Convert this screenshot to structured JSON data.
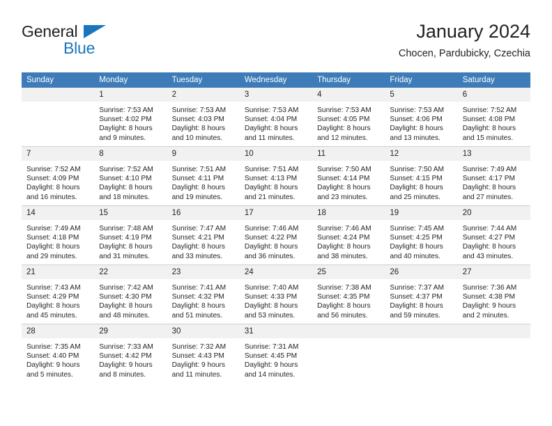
{
  "brand": {
    "line1": "General",
    "line2": "Blue",
    "accent_color": "#1b75bb",
    "text_color": "#231f20"
  },
  "header": {
    "title": "January 2024",
    "subtitle": "Chocen, Pardubicky, Czechia"
  },
  "calendar": {
    "header_bg": "#3d7cb8",
    "daynum_bg": "#f1f1f1",
    "weekday_labels": [
      "Sunday",
      "Monday",
      "Tuesday",
      "Wednesday",
      "Thursday",
      "Friday",
      "Saturday"
    ],
    "labels": {
      "sunrise_prefix": "Sunrise:",
      "sunset_prefix": "Sunset:",
      "daylight_prefix": "Daylight:"
    },
    "weeks": [
      [
        {
          "day": "",
          "blank": true
        },
        {
          "day": "1",
          "sunrise": "Sunrise: 7:53 AM",
          "sunset": "Sunset: 4:02 PM",
          "daylight": "Daylight: 8 hours and 9 minutes."
        },
        {
          "day": "2",
          "sunrise": "Sunrise: 7:53 AM",
          "sunset": "Sunset: 4:03 PM",
          "daylight": "Daylight: 8 hours and 10 minutes."
        },
        {
          "day": "3",
          "sunrise": "Sunrise: 7:53 AM",
          "sunset": "Sunset: 4:04 PM",
          "daylight": "Daylight: 8 hours and 11 minutes."
        },
        {
          "day": "4",
          "sunrise": "Sunrise: 7:53 AM",
          "sunset": "Sunset: 4:05 PM",
          "daylight": "Daylight: 8 hours and 12 minutes."
        },
        {
          "day": "5",
          "sunrise": "Sunrise: 7:53 AM",
          "sunset": "Sunset: 4:06 PM",
          "daylight": "Daylight: 8 hours and 13 minutes."
        },
        {
          "day": "6",
          "sunrise": "Sunrise: 7:52 AM",
          "sunset": "Sunset: 4:08 PM",
          "daylight": "Daylight: 8 hours and 15 minutes."
        }
      ],
      [
        {
          "day": "7",
          "sunrise": "Sunrise: 7:52 AM",
          "sunset": "Sunset: 4:09 PM",
          "daylight": "Daylight: 8 hours and 16 minutes."
        },
        {
          "day": "8",
          "sunrise": "Sunrise: 7:52 AM",
          "sunset": "Sunset: 4:10 PM",
          "daylight": "Daylight: 8 hours and 18 minutes."
        },
        {
          "day": "9",
          "sunrise": "Sunrise: 7:51 AM",
          "sunset": "Sunset: 4:11 PM",
          "daylight": "Daylight: 8 hours and 19 minutes."
        },
        {
          "day": "10",
          "sunrise": "Sunrise: 7:51 AM",
          "sunset": "Sunset: 4:13 PM",
          "daylight": "Daylight: 8 hours and 21 minutes."
        },
        {
          "day": "11",
          "sunrise": "Sunrise: 7:50 AM",
          "sunset": "Sunset: 4:14 PM",
          "daylight": "Daylight: 8 hours and 23 minutes."
        },
        {
          "day": "12",
          "sunrise": "Sunrise: 7:50 AM",
          "sunset": "Sunset: 4:15 PM",
          "daylight": "Daylight: 8 hours and 25 minutes."
        },
        {
          "day": "13",
          "sunrise": "Sunrise: 7:49 AM",
          "sunset": "Sunset: 4:17 PM",
          "daylight": "Daylight: 8 hours and 27 minutes."
        }
      ],
      [
        {
          "day": "14",
          "sunrise": "Sunrise: 7:49 AM",
          "sunset": "Sunset: 4:18 PM",
          "daylight": "Daylight: 8 hours and 29 minutes."
        },
        {
          "day": "15",
          "sunrise": "Sunrise: 7:48 AM",
          "sunset": "Sunset: 4:19 PM",
          "daylight": "Daylight: 8 hours and 31 minutes."
        },
        {
          "day": "16",
          "sunrise": "Sunrise: 7:47 AM",
          "sunset": "Sunset: 4:21 PM",
          "daylight": "Daylight: 8 hours and 33 minutes."
        },
        {
          "day": "17",
          "sunrise": "Sunrise: 7:46 AM",
          "sunset": "Sunset: 4:22 PM",
          "daylight": "Daylight: 8 hours and 36 minutes."
        },
        {
          "day": "18",
          "sunrise": "Sunrise: 7:46 AM",
          "sunset": "Sunset: 4:24 PM",
          "daylight": "Daylight: 8 hours and 38 minutes."
        },
        {
          "day": "19",
          "sunrise": "Sunrise: 7:45 AM",
          "sunset": "Sunset: 4:25 PM",
          "daylight": "Daylight: 8 hours and 40 minutes."
        },
        {
          "day": "20",
          "sunrise": "Sunrise: 7:44 AM",
          "sunset": "Sunset: 4:27 PM",
          "daylight": "Daylight: 8 hours and 43 minutes."
        }
      ],
      [
        {
          "day": "21",
          "sunrise": "Sunrise: 7:43 AM",
          "sunset": "Sunset: 4:29 PM",
          "daylight": "Daylight: 8 hours and 45 minutes."
        },
        {
          "day": "22",
          "sunrise": "Sunrise: 7:42 AM",
          "sunset": "Sunset: 4:30 PM",
          "daylight": "Daylight: 8 hours and 48 minutes."
        },
        {
          "day": "23",
          "sunrise": "Sunrise: 7:41 AM",
          "sunset": "Sunset: 4:32 PM",
          "daylight": "Daylight: 8 hours and 51 minutes."
        },
        {
          "day": "24",
          "sunrise": "Sunrise: 7:40 AM",
          "sunset": "Sunset: 4:33 PM",
          "daylight": "Daylight: 8 hours and 53 minutes."
        },
        {
          "day": "25",
          "sunrise": "Sunrise: 7:38 AM",
          "sunset": "Sunset: 4:35 PM",
          "daylight": "Daylight: 8 hours and 56 minutes."
        },
        {
          "day": "26",
          "sunrise": "Sunrise: 7:37 AM",
          "sunset": "Sunset: 4:37 PM",
          "daylight": "Daylight: 8 hours and 59 minutes."
        },
        {
          "day": "27",
          "sunrise": "Sunrise: 7:36 AM",
          "sunset": "Sunset: 4:38 PM",
          "daylight": "Daylight: 9 hours and 2 minutes."
        }
      ],
      [
        {
          "day": "28",
          "sunrise": "Sunrise: 7:35 AM",
          "sunset": "Sunset: 4:40 PM",
          "daylight": "Daylight: 9 hours and 5 minutes."
        },
        {
          "day": "29",
          "sunrise": "Sunrise: 7:33 AM",
          "sunset": "Sunset: 4:42 PM",
          "daylight": "Daylight: 9 hours and 8 minutes."
        },
        {
          "day": "30",
          "sunrise": "Sunrise: 7:32 AM",
          "sunset": "Sunset: 4:43 PM",
          "daylight": "Daylight: 9 hours and 11 minutes."
        },
        {
          "day": "31",
          "sunrise": "Sunrise: 7:31 AM",
          "sunset": "Sunset: 4:45 PM",
          "daylight": "Daylight: 9 hours and 14 minutes."
        },
        {
          "day": "",
          "blank": true
        },
        {
          "day": "",
          "blank": true
        },
        {
          "day": "",
          "blank": true
        }
      ]
    ]
  }
}
